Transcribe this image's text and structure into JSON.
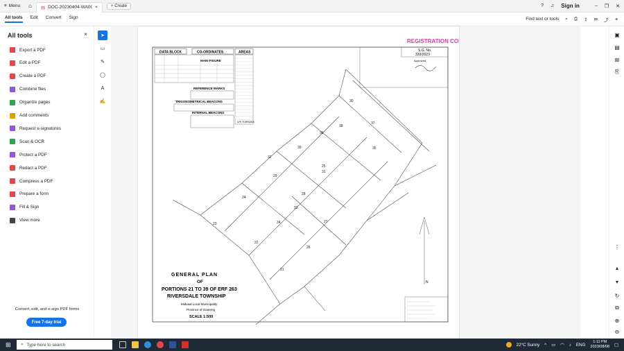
{
  "titlebar": {
    "menu_label": "Menu",
    "tab_title": "DOC-20230404-WA0019...",
    "create_label": "Create",
    "signin_label": "Sign in"
  },
  "toolbar": {
    "nav": [
      "All tools",
      "Edit",
      "Convert",
      "Sign"
    ],
    "find_label": "Find text or tools"
  },
  "sidebar": {
    "title": "All tools",
    "items": [
      {
        "label": "Export a PDF",
        "color": "#e34850"
      },
      {
        "label": "Edit a PDF",
        "color": "#e34850"
      },
      {
        "label": "Create a PDF",
        "color": "#e34850"
      },
      {
        "label": "Combine files",
        "color": "#9256d9"
      },
      {
        "label": "Organize pages",
        "color": "#2da44e"
      },
      {
        "label": "Add comments",
        "color": "#d7a400"
      },
      {
        "label": "Request e-signatures",
        "color": "#9256d9"
      },
      {
        "label": "Scan & OCR",
        "color": "#2da44e"
      },
      {
        "label": "Protect a PDF",
        "color": "#9256d9"
      },
      {
        "label": "Redact a PDF",
        "color": "#e34850"
      },
      {
        "label": "Compress a PDF",
        "color": "#e34850"
      },
      {
        "label": "Prepare a form",
        "color": "#e34850"
      },
      {
        "label": "Fill & Sign",
        "color": "#9256d9"
      },
      {
        "label": "View more",
        "color": "#444444"
      }
    ],
    "promo_text": "Convert, edit, and e-sign PDF forms",
    "trial_label": "Free 7-day trial"
  },
  "document": {
    "stamp": "REGISTRATION COPY",
    "data_block": "DATA BLOCK",
    "coordinates": "CO-ORDINATES",
    "main_figure": "MAIN FIGURE",
    "areas": "AREAS",
    "reference_marks": "REFERENCE MARKS",
    "trig_beacons": "TRIGONOMETRICAL BEACONS",
    "internal_beacons": "INTERNAL BEACONS",
    "lpi": "LPI T0IR0263",
    "sg_no_label": "S.G. No.",
    "sg_no": "333/2023",
    "approved": "Approved",
    "plan_title_1": "GENERAL   PLAN",
    "plan_title_2": "OF",
    "plan_title_3": "PORTIONS 21 TO 39 OF ERF 263",
    "plan_title_4": "RIVERSDALE TOWNSHIP",
    "municipality": "Midvaal Local Municipality",
    "province": "Province of Gauteng",
    "scale": "SCALE 1:500",
    "portion_numbers": [
      "21",
      "22",
      "23",
      "24",
      "25",
      "26",
      "27",
      "28",
      "29",
      "30",
      "31",
      "32",
      "33",
      "34",
      "35",
      "36",
      "37",
      "38",
      "39"
    ]
  },
  "taskbar": {
    "search_placeholder": "Type here to search",
    "weather": "22°C  Sunny",
    "lang": "ENG",
    "time": "1:11 PM",
    "date": "2023/08/08"
  }
}
